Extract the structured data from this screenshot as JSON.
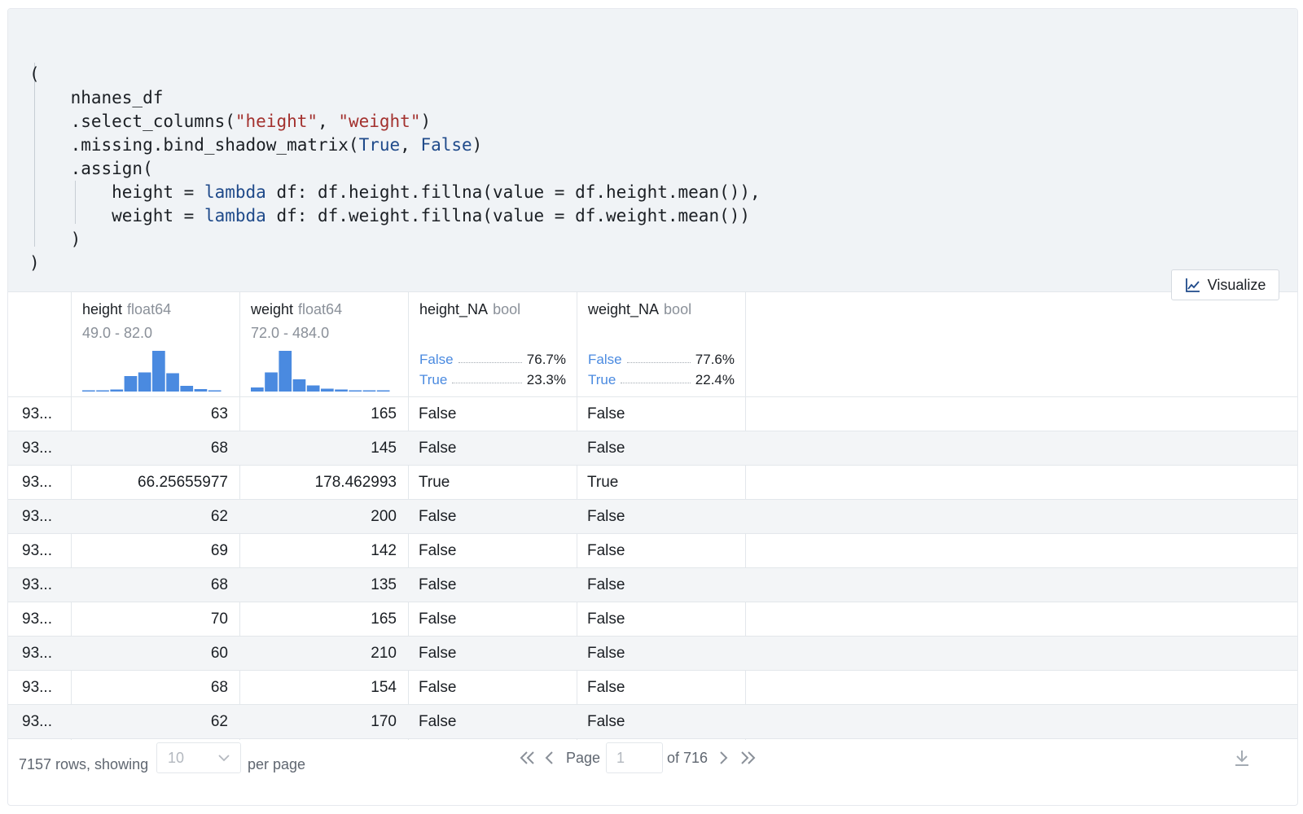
{
  "code": {
    "lines": [
      {
        "segs": [
          {
            "t": "("
          }
        ]
      },
      {
        "segs": [
          {
            "t": "    nhanes_df"
          }
        ]
      },
      {
        "segs": [
          {
            "t": "    .select_columns("
          },
          {
            "t": "\"height\"",
            "c": "st"
          },
          {
            "t": ", "
          },
          {
            "t": "\"weight\"",
            "c": "st"
          },
          {
            "t": ")"
          }
        ]
      },
      {
        "segs": [
          {
            "t": "    .missing.bind_shadow_matrix("
          },
          {
            "t": "True",
            "c": "kw"
          },
          {
            "t": ", "
          },
          {
            "t": "False",
            "c": "kw"
          },
          {
            "t": ")"
          }
        ]
      },
      {
        "segs": [
          {
            "t": "    .assign("
          }
        ]
      },
      {
        "segs": [
          {
            "t": "        height = "
          },
          {
            "t": "lambda",
            "c": "kw"
          },
          {
            "t": " df: df.height.fillna(value = df.height.mean()),"
          }
        ]
      },
      {
        "segs": [
          {
            "t": "        weight = "
          },
          {
            "t": "lambda",
            "c": "kw"
          },
          {
            "t": " df: df.weight.fillna(value = df.weight.mean())"
          }
        ]
      },
      {
        "segs": [
          {
            "t": "    )"
          }
        ]
      },
      {
        "segs": [
          {
            "t": ")"
          }
        ]
      }
    ]
  },
  "toolbar": {
    "visualize_label": "Visualize",
    "visualize_icon": "line-chart-icon"
  },
  "columns": {
    "height": {
      "name": "height",
      "dtype": "float64",
      "range": "49.0 - 82.0",
      "hist": [
        0.03,
        0.03,
        0.05,
        0.38,
        0.47,
        1.0,
        0.45,
        0.14,
        0.06,
        0.03
      ]
    },
    "weight": {
      "name": "weight",
      "dtype": "float64",
      "range": "72.0 - 484.0",
      "hist": [
        0.1,
        0.47,
        1.0,
        0.3,
        0.15,
        0.07,
        0.05,
        0.03,
        0.03,
        0.03
      ]
    },
    "height_na": {
      "name": "height_NA",
      "dtype": "bool",
      "false_label": "False",
      "false_pct": "76.7%",
      "true_label": "True",
      "true_pct": "23.3%"
    },
    "weight_na": {
      "name": "weight_NA",
      "dtype": "bool",
      "false_label": "False",
      "false_pct": "77.6%",
      "true_label": "True",
      "true_pct": "22.4%"
    }
  },
  "rows": [
    {
      "idx": "93...",
      "height": "63",
      "weight": "165",
      "height_na": "False",
      "weight_na": "False"
    },
    {
      "idx": "93...",
      "height": "68",
      "weight": "145",
      "height_na": "False",
      "weight_na": "False"
    },
    {
      "idx": "93...",
      "height": "66.25655977",
      "weight": "178.462993",
      "height_na": "True",
      "weight_na": "True"
    },
    {
      "idx": "93...",
      "height": "62",
      "weight": "200",
      "height_na": "False",
      "weight_na": "False"
    },
    {
      "idx": "93...",
      "height": "69",
      "weight": "142",
      "height_na": "False",
      "weight_na": "False"
    },
    {
      "idx": "93...",
      "height": "68",
      "weight": "135",
      "height_na": "False",
      "weight_na": "False"
    },
    {
      "idx": "93...",
      "height": "70",
      "weight": "165",
      "height_na": "False",
      "weight_na": "False"
    },
    {
      "idx": "93...",
      "height": "60",
      "weight": "210",
      "height_na": "False",
      "weight_na": "False"
    },
    {
      "idx": "93...",
      "height": "68",
      "weight": "154",
      "height_na": "False",
      "weight_na": "False"
    },
    {
      "idx": "93...",
      "height": "62",
      "weight": "170",
      "height_na": "False",
      "weight_na": "False"
    }
  ],
  "footer": {
    "rows_text": "7157 rows, showing",
    "page_size": "10",
    "per_page": "per page",
    "page_label": "Page",
    "page_value": "1",
    "of_pages": "of 716"
  },
  "colors": {
    "hist_bar": "#4a8ae0",
    "bool_label": "#4a8ae0",
    "keyword": "#1f4a8a",
    "string": "#a3312e",
    "code_bg": "#f0f3f6"
  }
}
